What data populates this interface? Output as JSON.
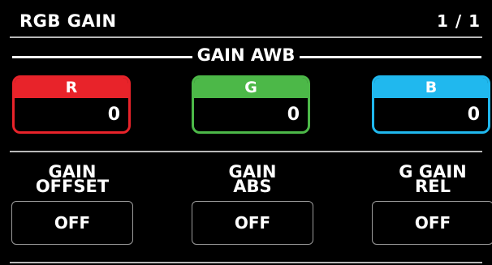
{
  "header": {
    "title": "RGB GAIN",
    "page": "1 / 1"
  },
  "section": {
    "title": "GAIN AWB"
  },
  "gains": [
    {
      "label": "R",
      "value": "0",
      "color": "#e8232a"
    },
    {
      "label": "G",
      "value": "0",
      "color": "#4cb848"
    },
    {
      "label": "B",
      "value": "0",
      "color": "#20b8ee"
    }
  ],
  "params": [
    {
      "label_line1": "GAIN",
      "label_line2": "OFFSET",
      "value": "OFF"
    },
    {
      "label_line1": "GAIN",
      "label_line2": "ABS",
      "value": "OFF"
    },
    {
      "label_line1": "G GAIN",
      "label_line2": "REL",
      "value": "OFF"
    }
  ],
  "colors": {
    "background": "#000000",
    "divider": "#b8b8b8",
    "button_border": "#9a9a9a"
  }
}
